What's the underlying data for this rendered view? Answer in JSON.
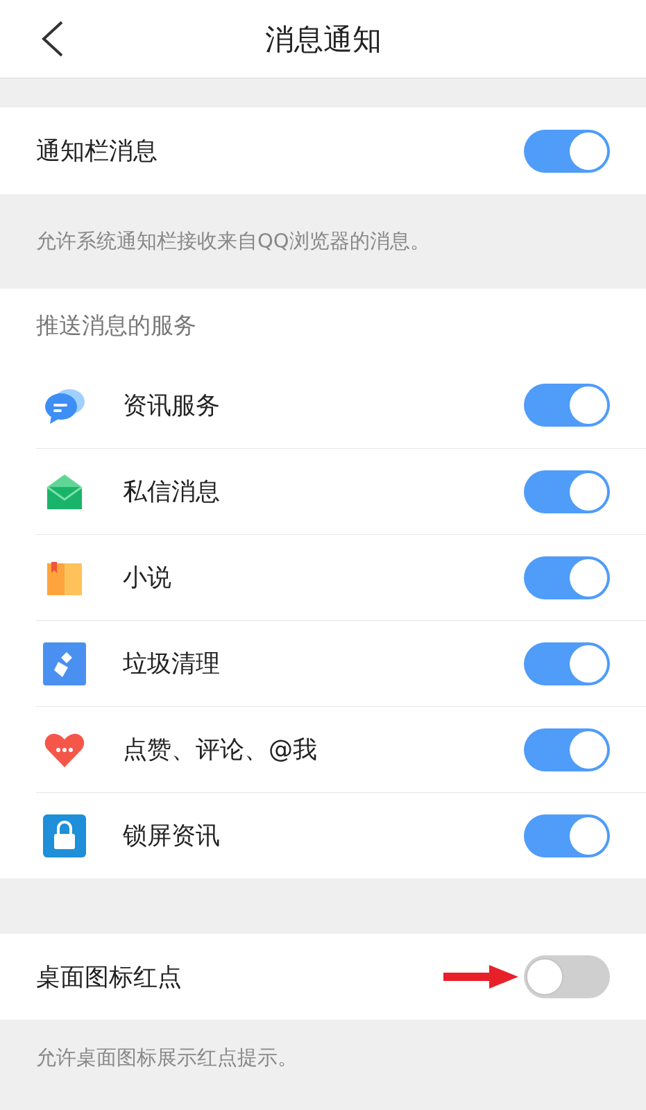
{
  "header": {
    "title": "消息通知"
  },
  "notification_bar": {
    "label": "通知栏消息",
    "on": true,
    "description": "允许系统通知栏接收来自QQ浏览器的消息。"
  },
  "push_services": {
    "heading": "推送消息的服务",
    "items": [
      {
        "label": "资讯服务",
        "on": true
      },
      {
        "label": "私信消息",
        "on": true
      },
      {
        "label": "小说",
        "on": true
      },
      {
        "label": "垃圾清理",
        "on": true
      },
      {
        "label": "点赞、评论、@我",
        "on": true
      },
      {
        "label": "锁屏资讯",
        "on": true
      }
    ]
  },
  "badge_dot": {
    "label": "桌面图标红点",
    "on": false,
    "description": "允许桌面图标展示红点提示。"
  }
}
